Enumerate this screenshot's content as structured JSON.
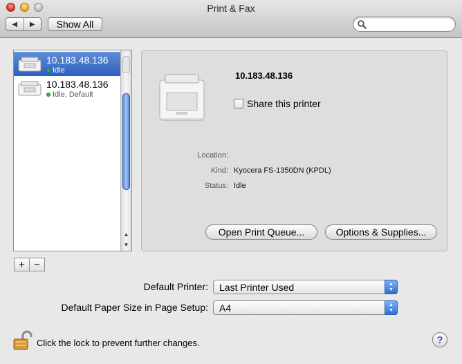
{
  "window": {
    "title": "Print & Fax"
  },
  "toolbar": {
    "back_glyph": "◀",
    "forward_glyph": "▶",
    "show_all_label": "Show All",
    "search_placeholder": "",
    "search_icon": "magnifier-icon"
  },
  "printers": [
    {
      "name": "10.183.48.136",
      "status": "Idle",
      "selected": true
    },
    {
      "name": "10.183.48.136",
      "status": "Idle, Default",
      "selected": false
    }
  ],
  "list_controls": {
    "add_label": "+",
    "remove_label": "−"
  },
  "detail": {
    "printer_name": "10.183.48.136",
    "share_label": "Share this printer",
    "share_checked": false,
    "location_label": "Location:",
    "location_value": "",
    "kind_label": "Kind:",
    "kind_value": "Kyocera FS-1350DN (KPDL)",
    "status_label": "Status:",
    "status_value": "Idle",
    "open_queue_label": "Open Print Queue...",
    "options_label": "Options & Supplies..."
  },
  "defaults": {
    "default_printer_label": "Default Printer:",
    "default_printer_value": "Last Printer Used",
    "paper_size_label": "Default Paper Size in Page Setup:",
    "paper_size_value": "A4"
  },
  "footer": {
    "lock_text": "Click the lock to prevent further changes.",
    "help_label": "?"
  },
  "colors": {
    "selection": "#3a6bc8",
    "status_dot": "#3bb53b",
    "help_accent": "#7a3fbf"
  }
}
